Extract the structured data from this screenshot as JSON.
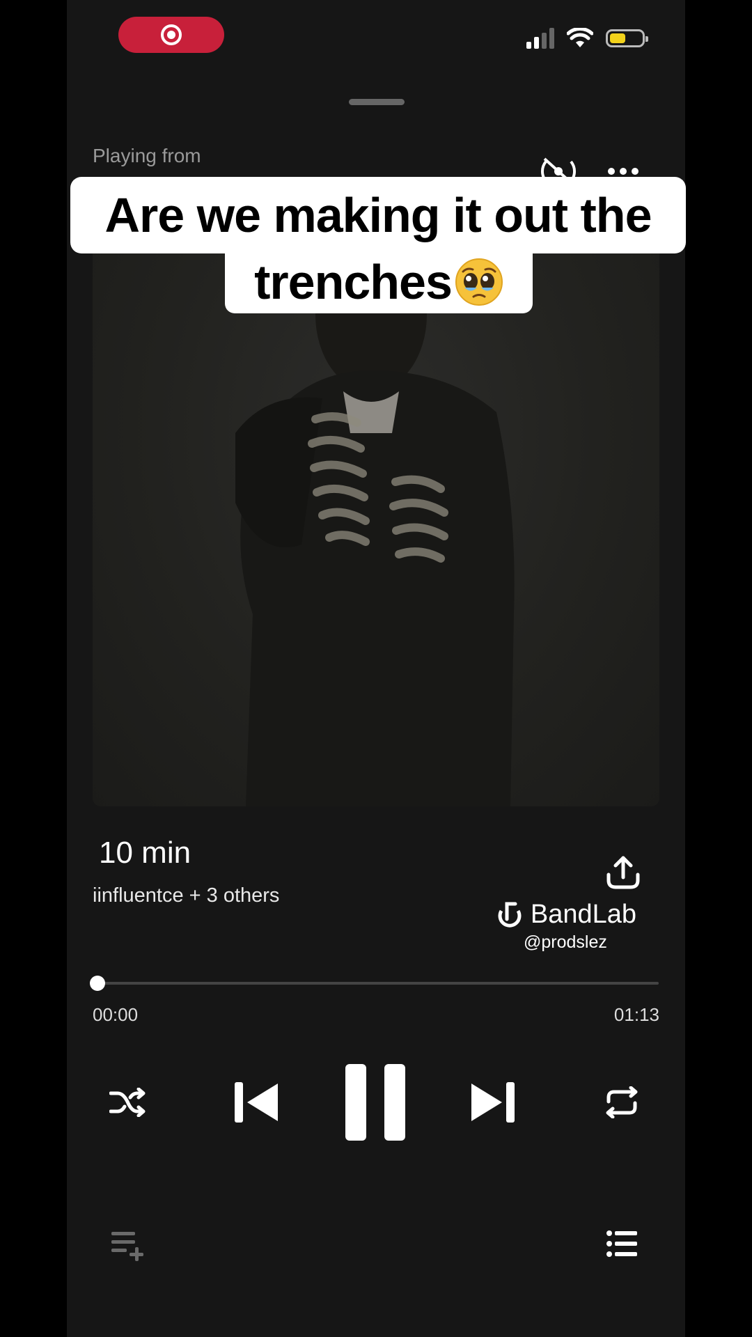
{
  "player": {
    "playing_from_label": "Playing from",
    "caption_line1": "Are we making it out the",
    "caption_line2": "trenches",
    "caption_emoji": "pleading-face-emoji",
    "track_title": "10  min",
    "artist": "iinfluentce + 3 others",
    "watermark": {
      "brand": "BandLab",
      "handle": "@prodslez"
    },
    "progress": {
      "current": "00:00",
      "total": "01:13",
      "fraction": 0.0
    },
    "state": "playing"
  },
  "status_bar": {
    "recording_indicator": "record-icon",
    "signal_bars_active": 2,
    "battery_color": "#f2d21b"
  },
  "colors": {
    "background": "#161616",
    "record": "#c8203a",
    "accent": "#ffffff"
  },
  "icons": {
    "cast": "cast-off-icon",
    "more": "more-icon",
    "share": "share-icon",
    "shuffle": "shuffle-icon",
    "previous": "skip-previous-icon",
    "pause": "pause-icon",
    "next": "skip-next-icon",
    "repeat": "repeat-icon",
    "add_to_queue": "add-to-queue-icon",
    "queue": "queue-list-icon"
  }
}
